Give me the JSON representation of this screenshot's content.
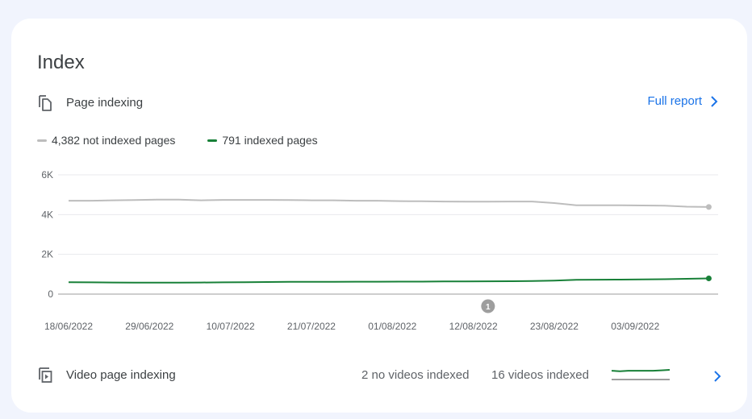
{
  "card": {
    "title": "Index",
    "page_indexing": {
      "label": "Page indexing",
      "icon": "pages-icon",
      "full_report_label": "Full report",
      "full_report_icon": "chevron-right-icon"
    },
    "video_indexing": {
      "label": "Video page indexing",
      "icon": "video-pages-icon",
      "no_videos_stat": "2 no videos indexed",
      "videos_stat": "16 videos indexed",
      "chevron_icon": "chevron-right-icon",
      "sparkline": {
        "indexed": [
          16,
          15,
          16,
          16,
          16,
          16,
          17,
          18
        ],
        "not_indexed": [
          2,
          2,
          2,
          2,
          2,
          2,
          2,
          2
        ]
      }
    }
  },
  "colors": {
    "not_indexed": "#bdbdbd",
    "indexed": "#188038",
    "link": "#1a73e8",
    "annotation": "#9e9e9e"
  },
  "chart_data": {
    "type": "line",
    "title": "Page indexing",
    "xlabel": "",
    "ylabel": "",
    "ylim": [
      0,
      6000
    ],
    "yticks": [
      0,
      2000,
      4000,
      6000
    ],
    "ytick_labels": [
      "0",
      "2K",
      "4K",
      "6K"
    ],
    "xtick_labels": [
      "18/06/2022",
      "29/06/2022",
      "10/07/2022",
      "21/07/2022",
      "01/08/2022",
      "12/08/2022",
      "23/08/2022",
      "03/09/2022"
    ],
    "xtick_day_offsets": [
      0,
      11,
      22,
      33,
      44,
      55,
      66,
      77
    ],
    "grid": true,
    "legend_position": "top-left",
    "annotations": [
      {
        "label": "1",
        "day_offset": 57
      }
    ],
    "day_offsets": [
      0,
      3,
      6,
      9,
      12,
      15,
      18,
      21,
      24,
      27,
      30,
      33,
      36,
      39,
      42,
      45,
      48,
      51,
      54,
      57,
      60,
      63,
      66,
      69,
      72,
      75,
      78,
      81,
      84,
      87
    ],
    "series": [
      {
        "name": "4,382 not indexed pages",
        "values": [
          4700,
          4700,
          4720,
          4730,
          4750,
          4750,
          4720,
          4740,
          4740,
          4740,
          4730,
          4720,
          4720,
          4700,
          4700,
          4680,
          4670,
          4660,
          4650,
          4650,
          4660,
          4660,
          4580,
          4470,
          4470,
          4470,
          4460,
          4450,
          4400,
          4382
        ]
      },
      {
        "name": "791 indexed pages",
        "values": [
          600,
          590,
          585,
          580,
          575,
          575,
          585,
          590,
          600,
          610,
          615,
          620,
          620,
          625,
          625,
          630,
          630,
          635,
          640,
          645,
          650,
          660,
          680,
          720,
          725,
          730,
          740,
          750,
          770,
          791
        ]
      }
    ]
  }
}
